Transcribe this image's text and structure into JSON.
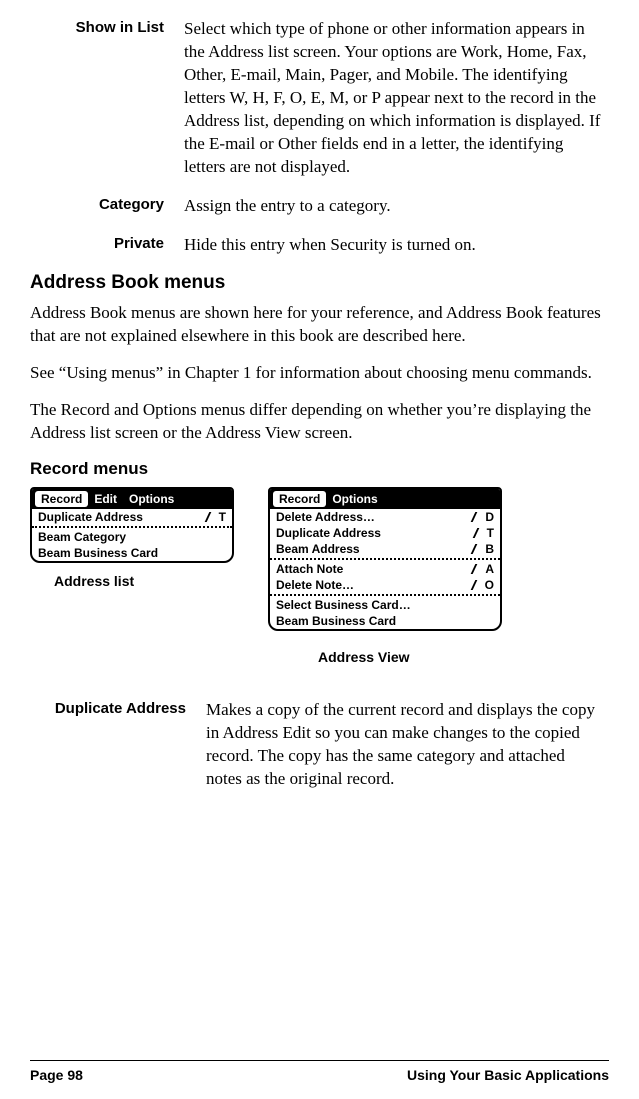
{
  "defs1": [
    {
      "term": "Show in List",
      "desc": "Select which type of phone or other information appears in the Address list screen. Your options are Work, Home, Fax, Other, E-mail, Main, Pager, and Mobile. The identifying letters W, H, F, O, E, M, or P appear next to the record in the Address list, depending on which information is displayed. If the E-mail or Other fields end in a letter, the identifying letters are not displayed."
    },
    {
      "term": "Category",
      "desc": "Assign the entry to a category."
    },
    {
      "term": "Private",
      "desc": "Hide this entry when Security is turned on."
    }
  ],
  "heading_addrbook_menus": "Address Book menus",
  "para1": "Address Book menus are shown here for your reference, and Address Book features that are not explained elsewhere in this book are described here.",
  "para2": "See “Using menus” in Chapter 1 for information about choosing menu commands.",
  "para3": "The Record and Options menus differ depending on whether you’re displaying the Address list screen or the Address View screen.",
  "heading_record_menus": "Record menus",
  "menu_left": {
    "caption": "Address list",
    "tabs": [
      "Record",
      "Edit",
      "Options"
    ],
    "active_tab": 0,
    "groups": [
      [
        {
          "label": "Duplicate Address",
          "shortcut": "T"
        }
      ],
      [
        {
          "label": "Beam Category"
        },
        {
          "label": "Beam Business Card"
        }
      ]
    ]
  },
  "menu_right": {
    "caption": "Address View",
    "tabs": [
      "Record",
      "Options"
    ],
    "active_tab": 0,
    "groups": [
      [
        {
          "label": "Delete Address…",
          "shortcut": "D"
        },
        {
          "label": "Duplicate Address",
          "shortcut": "T"
        },
        {
          "label": "Beam Address",
          "shortcut": "B"
        }
      ],
      [
        {
          "label": "Attach Note",
          "shortcut": "A"
        },
        {
          "label": "Delete Note…",
          "shortcut": "O"
        }
      ],
      [
        {
          "label": "Select Business Card…"
        },
        {
          "label": "Beam Business Card"
        }
      ]
    ]
  },
  "defs2": [
    {
      "term": "Duplicate Address",
      "desc": "Makes a copy of the current record and displays the copy in Address Edit so you can make changes to the copied record. The copy has the same category and attached notes as the original record."
    }
  ],
  "footer": {
    "left": "Page 98",
    "right": "Using Your Basic Applications"
  }
}
